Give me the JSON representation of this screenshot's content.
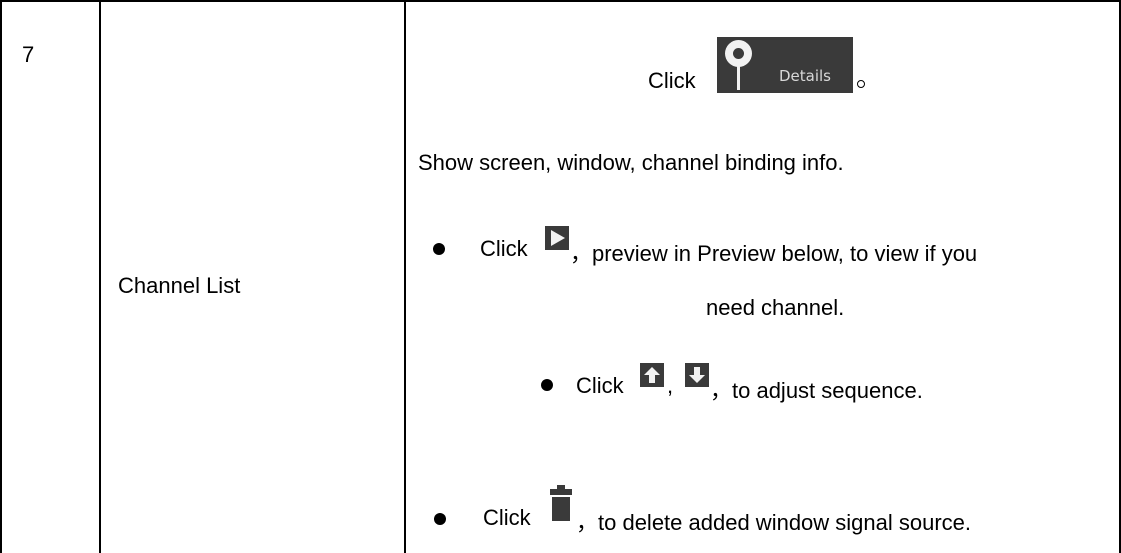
{
  "row": {
    "number": "7",
    "name": "Channel List"
  },
  "description": {
    "click_details_prefix": "Click",
    "details_button_label": "Details",
    "details_suffix": "。",
    "show_info": "Show screen, window, channel binding info.",
    "preview_click": "Click",
    "preview_text_line1": "，preview in Preview below, to view if you",
    "preview_text_line2": "need channel.",
    "sequence_click": "Click",
    "sequence_comma": ",",
    "sequence_text": "，to adjust sequence.",
    "delete_click": "Click",
    "delete_text": "，to delete added window signal source."
  },
  "icons": {
    "details": "location-pin-icon",
    "preview": "play-icon",
    "up": "arrow-up-icon",
    "down": "arrow-down-icon",
    "delete": "trash-icon"
  },
  "colors": {
    "icon_bg": "#3a3a3a",
    "icon_fg": "#f2f2f2"
  }
}
